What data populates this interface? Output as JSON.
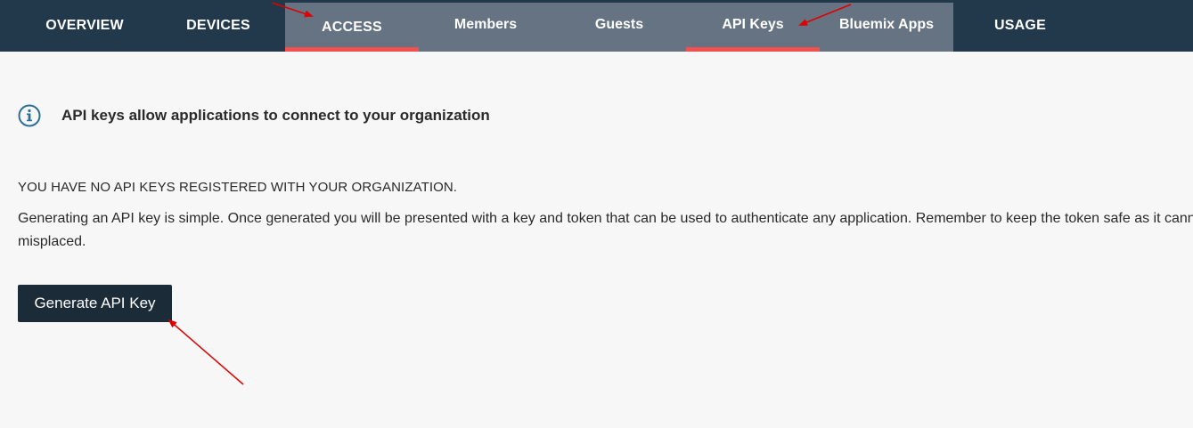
{
  "nav": {
    "tabs": [
      {
        "label": "OVERVIEW",
        "active": false
      },
      {
        "label": "DEVICES",
        "active": false
      },
      {
        "label": "ACCESS",
        "active": true
      },
      {
        "label": "USAGE",
        "active": false
      }
    ],
    "subtabs": [
      {
        "label": "Members",
        "active": false
      },
      {
        "label": "Guests",
        "active": false
      },
      {
        "label": "API Keys",
        "active": true
      },
      {
        "label": "Bluemix Apps",
        "active": false
      }
    ]
  },
  "info": {
    "icon": "info-circle-icon",
    "text": "API keys allow applications to connect to your organization"
  },
  "empty_state": {
    "heading": "YOU HAVE NO API KEYS REGISTERED WITH YOUR ORGANIZATION.",
    "description_line1": "Generating an API key is simple. Once generated you will be presented with a key and token that can be used to authenticate any application. Remember to keep the token safe as it cannot be recovered if",
    "description_line2": "misplaced."
  },
  "actions": {
    "generate_label": "Generate API Key"
  },
  "colors": {
    "topnav_bg": "#22394c",
    "subnav_bg": "#657383",
    "active_underline": "#f0504f",
    "button_bg": "#1b2b38",
    "page_bg": "#f7f7f7",
    "annotation_arrow": "#e00000",
    "info_icon": "#2b6f96"
  }
}
